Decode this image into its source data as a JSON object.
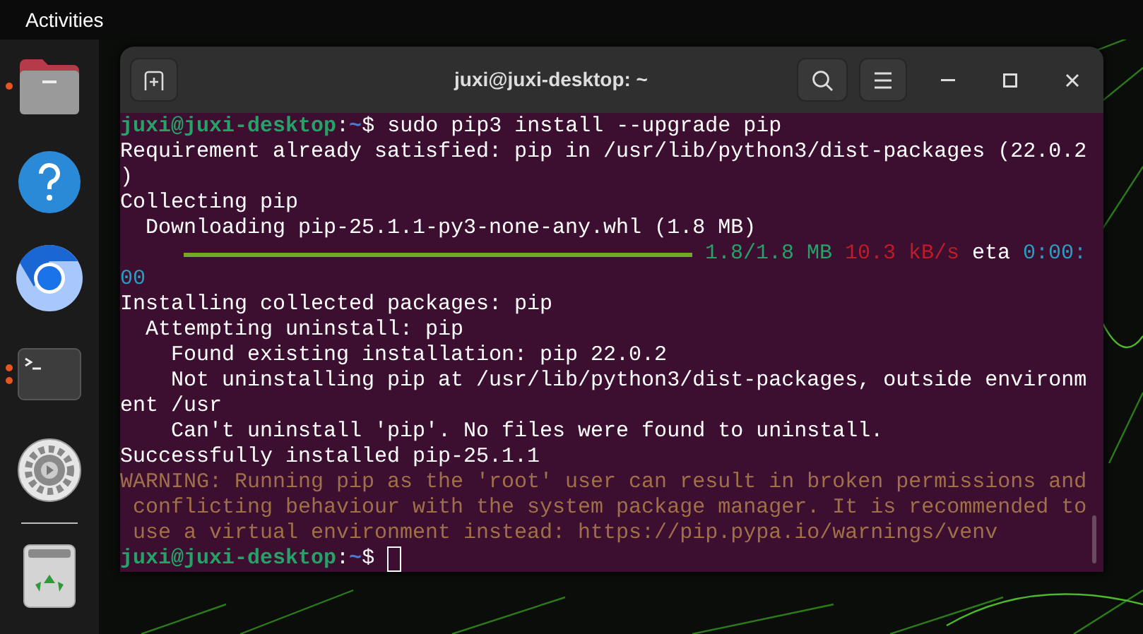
{
  "top_bar": {
    "activities": "Activities"
  },
  "dock": {
    "items": [
      {
        "kind": "files",
        "running": true,
        "multiple_windows": false
      },
      {
        "kind": "help",
        "running": false,
        "multiple_windows": false
      },
      {
        "kind": "browser",
        "running": false,
        "multiple_windows": false
      },
      {
        "kind": "terminal",
        "running": true,
        "multiple_windows": true
      },
      {
        "kind": "settings",
        "running": false,
        "multiple_windows": false
      },
      {
        "kind": "separator"
      },
      {
        "kind": "trash",
        "running": false,
        "multiple_windows": false
      }
    ]
  },
  "window": {
    "title": "juxi@juxi-desktop: ~"
  },
  "terminal": {
    "lines": [
      [
        {
          "kind": "user",
          "text": "juxi@juxi-desktop"
        },
        {
          "kind": "plain",
          "text": ":"
        },
        {
          "kind": "path",
          "text": "~"
        },
        {
          "kind": "command",
          "text": "$ sudo pip3 install --upgrade pip"
        }
      ],
      [
        {
          "kind": "plain",
          "text": "Requirement already satisfied: pip in /usr/lib/python3/dist-packages (22.0.2"
        }
      ],
      [
        {
          "kind": "plain",
          "text": ")"
        }
      ],
      [
        {
          "kind": "plain",
          "text": "Collecting pip"
        }
      ],
      [
        {
          "kind": "plain",
          "text": "  Downloading pip-25.1.1-py3-none-any.whl (1.8 MB)"
        }
      ],
      [
        {
          "kind": "progress",
          "level": 1.0
        },
        {
          "kind": "green",
          "text": "1.8/1.8 MB"
        },
        {
          "kind": "red",
          "text": "10.3 kB/s"
        },
        {
          "kind": "plain",
          "text": "eta"
        },
        {
          "kind": "cyan",
          "text": "0:00:"
        }
      ],
      [
        {
          "kind": "cyan",
          "text": "00"
        }
      ],
      [
        {
          "kind": "plain",
          "text": "Installing collected packages: pip"
        }
      ],
      [
        {
          "kind": "plain",
          "text": "  Attempting uninstall: pip"
        }
      ],
      [
        {
          "kind": "plain",
          "text": "    Found existing installation: pip 22.0.2"
        }
      ],
      [
        {
          "kind": "plain",
          "text": "    Not uninstalling pip at /usr/lib/python3/dist-packages, outside environm"
        }
      ],
      [
        {
          "kind": "plain",
          "text": "ent /usr"
        }
      ],
      [
        {
          "kind": "plain",
          "text": "    Can't uninstall 'pip'. No files were found to uninstall."
        }
      ],
      [
        {
          "kind": "plain",
          "text": "Successfully installed pip-25.1.1"
        }
      ],
      [
        {
          "kind": "warning",
          "text": "WARNING: Running pip as the 'root' user can result in broken permissions and"
        }
      ],
      [
        {
          "kind": "warning",
          "text": " conflicting behaviour with the system package manager. It is recommended to"
        }
      ],
      [
        {
          "kind": "warning",
          "text": " use a virtual environment instead: https://pip.pypa.io/warnings/venv"
        }
      ],
      [
        {
          "kind": "user",
          "text": "juxi@juxi-desktop"
        },
        {
          "kind": "plain",
          "text": ":"
        },
        {
          "kind": "path",
          "text": "~"
        },
        {
          "kind": "command",
          "text": "$"
        },
        {
          "kind": "cursor"
        }
      ]
    ]
  }
}
